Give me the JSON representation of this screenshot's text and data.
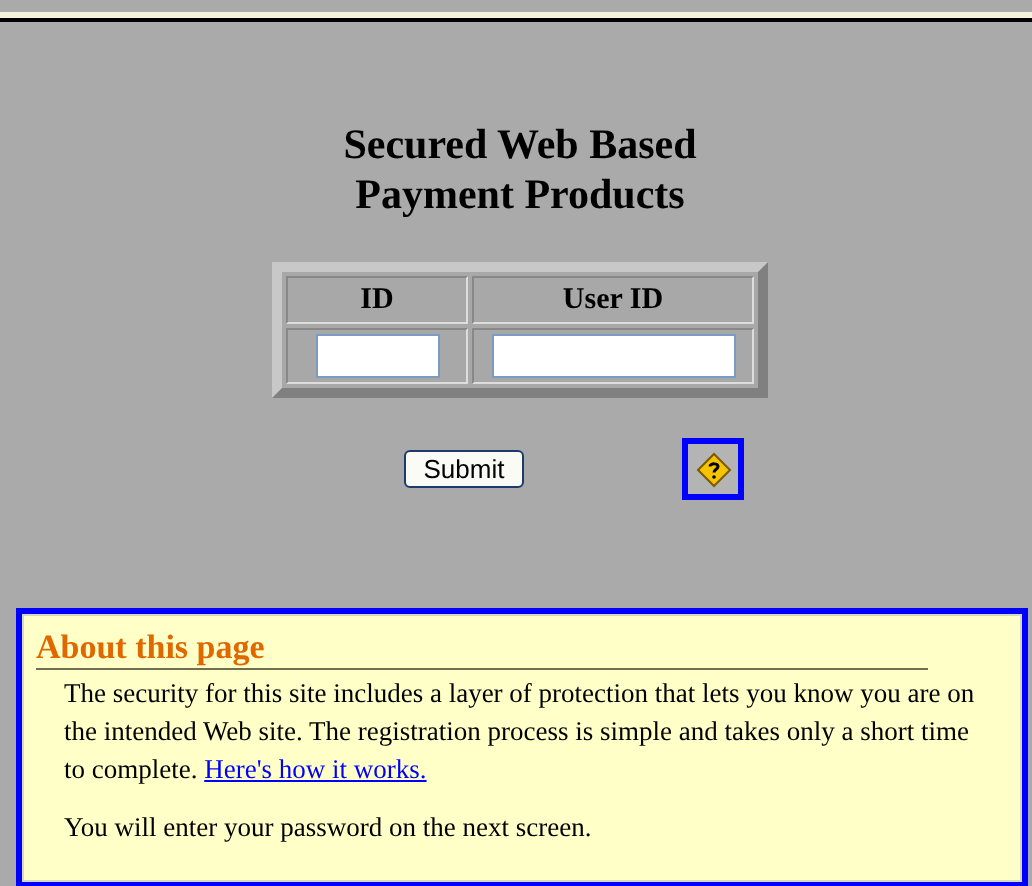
{
  "title": [
    "Secured Web Based",
    "Payment Products"
  ],
  "form": {
    "columns": [
      "ID",
      "User ID"
    ],
    "fields": [
      {
        "kind": "text"
      },
      {
        "kind": "text"
      }
    ],
    "submit": "Submit"
  },
  "about": {
    "heading": "About this page",
    "text": "The security for this site includes a layer of protection that lets you know you are on the intended Web site. The registration process is simple and takes only a short time to complete.",
    "link": "Here's how it works.",
    "note": "You will enter your password on the next screen."
  }
}
